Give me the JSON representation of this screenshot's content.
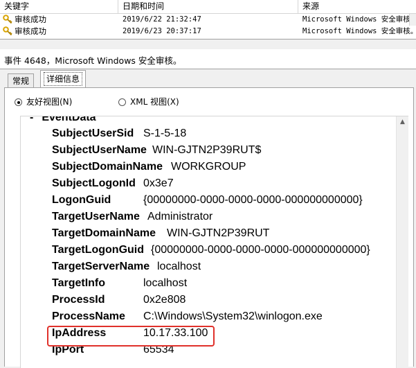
{
  "list": {
    "columns": [
      "关键字",
      "日期和时间",
      "来源"
    ],
    "rows": [
      {
        "keyword": "审核成功",
        "datetime": "2019/6/22 21:32:47",
        "source": "Microsoft Windows 安全审核。"
      },
      {
        "keyword": "审核成功",
        "datetime": "2019/6/23 20:37:17",
        "source": "Microsoft Windows 安全审核。"
      }
    ]
  },
  "event": {
    "title": "事件 4648，Microsoft Windows 安全审核。"
  },
  "tabs": [
    {
      "label": "常规",
      "active": false
    },
    {
      "label": "详细信息",
      "active": true
    }
  ],
  "view_mode": {
    "friendly": {
      "label": "友好视图(N)",
      "selected": true
    },
    "xml": {
      "label": "XML 视图(X)",
      "selected": false
    }
  },
  "event_data": {
    "section_label": "EventData",
    "collapse_glyph": "-",
    "fields": [
      {
        "name": "SubjectUserSid",
        "value": "S-1-5-18"
      },
      {
        "name": "SubjectUserName",
        "value": "WIN-GJTN2P39RUT$"
      },
      {
        "name": "SubjectDomainName",
        "value": "WORKGROUP"
      },
      {
        "name": "SubjectLogonId",
        "value": "0x3e7"
      },
      {
        "name": "LogonGuid",
        "value": "{00000000-0000-0000-0000-000000000000}"
      },
      {
        "name": "TargetUserName",
        "value": "Administrator"
      },
      {
        "name": "TargetDomainName",
        "value": "WIN-GJTN2P39RUT"
      },
      {
        "name": "TargetLogonGuid",
        "value": "{00000000-0000-0000-0000-000000000000}"
      },
      {
        "name": "TargetServerName",
        "value": "localhost"
      },
      {
        "name": "TargetInfo",
        "value": "localhost"
      },
      {
        "name": "ProcessId",
        "value": "0x2e808"
      },
      {
        "name": "ProcessName",
        "value": "C:\\Windows\\System32\\winlogon.exe"
      },
      {
        "name": "IpAddress",
        "value": "10.17.33.100"
      },
      {
        "name": "IpPort",
        "value": "65534"
      }
    ]
  },
  "colors": {
    "highlight": "#e0302a",
    "key_icon": "#d9a400"
  },
  "icons": {
    "row_icon": "key-icon",
    "scroll_up": "scroll-up-arrow-icon"
  }
}
